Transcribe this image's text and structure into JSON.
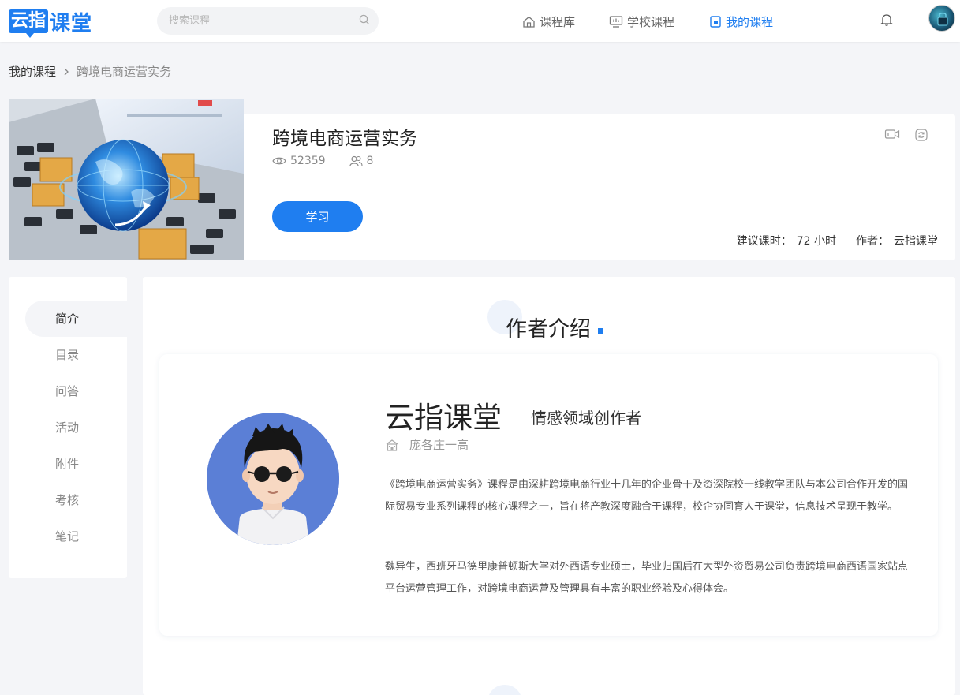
{
  "header": {
    "logo_box": "云指",
    "logo_rest": "课堂",
    "search_placeholder": "搜索课程",
    "nav": [
      {
        "label": "课程库",
        "icon": "home-icon",
        "active": false
      },
      {
        "label": "学校课程",
        "icon": "monitor-icon",
        "active": false
      },
      {
        "label": "我的课程",
        "icon": "book-icon",
        "active": true
      }
    ]
  },
  "breadcrumb": {
    "parent": "我的课程",
    "current": "跨境电商运营实务"
  },
  "course": {
    "title": "跨境电商运营实务",
    "views": "52359",
    "members": "8",
    "study_label": "学习",
    "hours_label": "建议课时：",
    "hours_value": "72 小时",
    "author_label": "作者：",
    "author_value": "云指课堂"
  },
  "sidebar": {
    "items": [
      {
        "label": "简介",
        "active": true
      },
      {
        "label": "目录",
        "active": false
      },
      {
        "label": "问答",
        "active": false
      },
      {
        "label": "活动",
        "active": false
      },
      {
        "label": "附件",
        "active": false
      },
      {
        "label": "考核",
        "active": false
      },
      {
        "label": "笔记",
        "active": false
      }
    ]
  },
  "main": {
    "section_title": "作者介绍",
    "author": {
      "name": "云指课堂",
      "role": "情感领域创作者",
      "school": "庞各庄一高",
      "desc1": "《跨境电商运营实务》课程是由深耕跨境电商行业十几年的企业骨干及资深院校一线教学团队与本公司合作开发的国际贸易专业系列课程的核心课程之一，旨在将产教深度融合于课程，校企协同育人于课堂，信息技术呈现于教学。",
      "desc2": "魏异生，西班牙马德里康普顿斯大学对外西语专业硕士，毕业归国后在大型外资贸易公司负责跨境电商西语国家站点平台运营管理工作，对跨境电商运营及管理具有丰富的职业经验及心得体会。"
    }
  },
  "colors": {
    "accent": "#1f7ef0",
    "background": "#f4f5f8"
  }
}
